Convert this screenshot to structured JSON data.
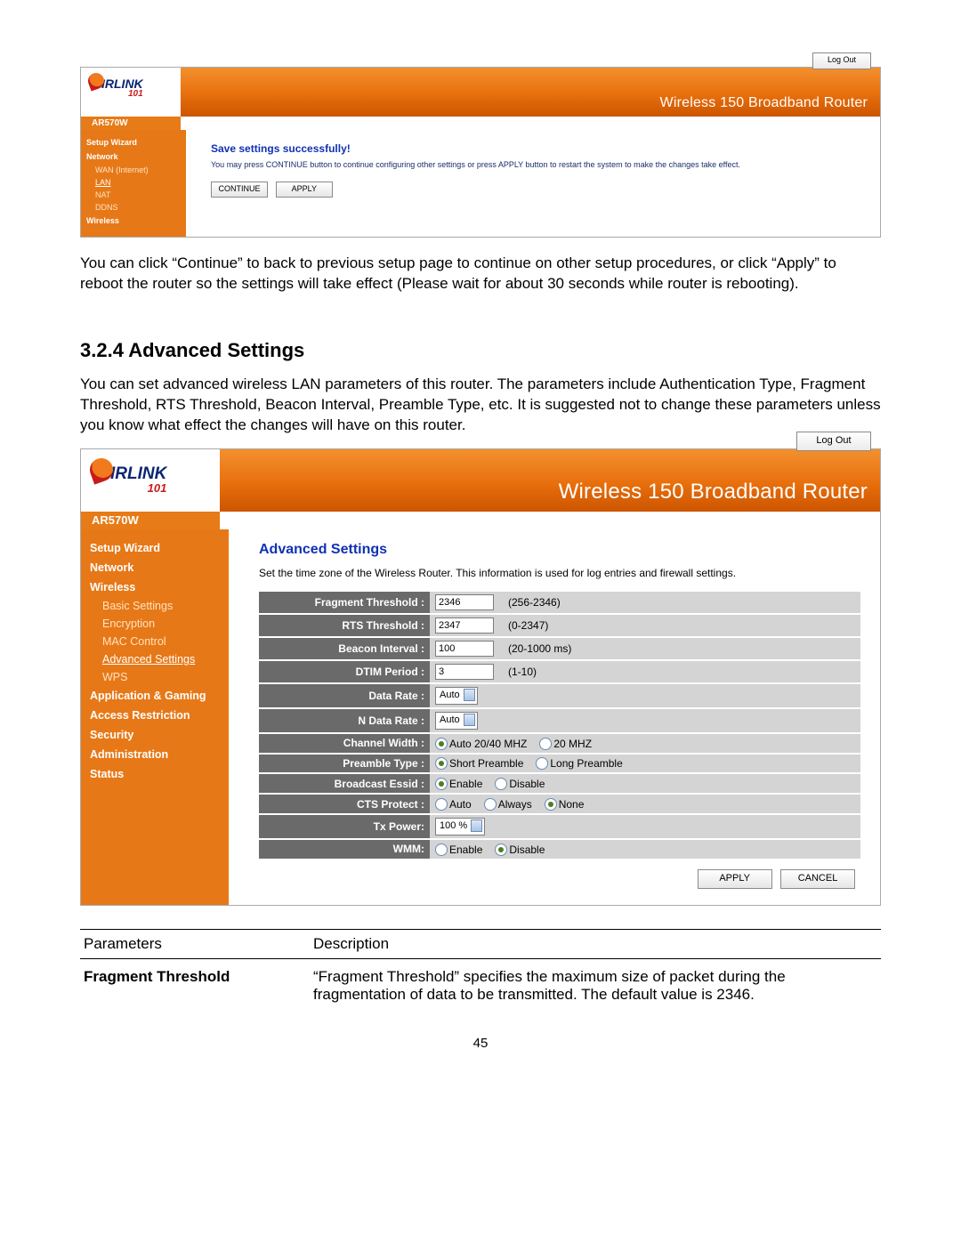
{
  "panel1": {
    "logout": "Log Out",
    "heading": "Wireless 150 Broadband Router",
    "model": "AR570W",
    "sidebar": {
      "items": [
        {
          "label": "Setup Wizard",
          "type": "sec"
        },
        {
          "label": "Network",
          "type": "sec"
        },
        {
          "label": "WAN (Internet)",
          "type": "sub"
        },
        {
          "label": "LAN",
          "type": "sub",
          "sel": true
        },
        {
          "label": "NAT",
          "type": "sub"
        },
        {
          "label": "DDNS",
          "type": "sub"
        },
        {
          "label": "Wireless",
          "type": "sec"
        }
      ]
    },
    "content": {
      "title": "Save settings successfully!",
      "hint": "You may press CONTINUE button to continue configuring other settings or press APPLY button to restart the system to make the changes take effect.",
      "btn_continue": "CONTINUE",
      "btn_apply": "APPLY"
    }
  },
  "para1": "You can click “Continue” to back to previous setup page to continue on other setup procedures, or click “Apply” to reboot the router so the settings will take effect (Please wait for about 30 seconds while router is rebooting).",
  "section_title": "3.2.4 Advanced Settings",
  "para2": "You can set advanced wireless LAN parameters of this router. The parameters include Authentication Type, Fragment Threshold, RTS Threshold, Beacon Interval, Preamble Type, etc. It is suggested not to change these parameters unless you know what effect the changes will have on this router.",
  "panel2": {
    "logout": "Log Out",
    "heading": "Wireless 150 Broadband Router",
    "model": "AR570W",
    "sidebar": {
      "items": [
        {
          "label": "Setup Wizard",
          "type": "sec"
        },
        {
          "label": "Network",
          "type": "sec"
        },
        {
          "label": "Wireless",
          "type": "sec"
        },
        {
          "label": "Basic Settings",
          "type": "sub"
        },
        {
          "label": "Encryption",
          "type": "sub"
        },
        {
          "label": "MAC Control",
          "type": "sub"
        },
        {
          "label": "Advanced Settings",
          "type": "sub",
          "sel": true
        },
        {
          "label": "WPS",
          "type": "sub"
        },
        {
          "label": "Application & Gaming",
          "type": "sec"
        },
        {
          "label": "Access Restriction",
          "type": "sec"
        },
        {
          "label": "Security",
          "type": "sec"
        },
        {
          "label": "Administration",
          "type": "sec"
        },
        {
          "label": "Status",
          "type": "sec"
        }
      ]
    },
    "content": {
      "title": "Advanced Settings",
      "hint": "Set the time zone of the Wireless Router. This information is used for log entries and firewall settings.",
      "rows": [
        {
          "label": "Fragment Threshold :",
          "kind": "input",
          "value": "2346",
          "note": "(256-2346)"
        },
        {
          "label": "RTS Threshold :",
          "kind": "input",
          "value": "2347",
          "note": "(0-2347)"
        },
        {
          "label": "Beacon Interval :",
          "kind": "input",
          "value": "100",
          "note": "(20-1000 ms)"
        },
        {
          "label": "DTIM Period :",
          "kind": "input",
          "value": "3",
          "note": "(1-10)"
        },
        {
          "label": "Data Rate :",
          "kind": "select",
          "value": "Auto"
        },
        {
          "label": "N Data Rate :",
          "kind": "select",
          "value": "Auto"
        },
        {
          "label": "Channel Width :",
          "kind": "radio",
          "options": [
            {
              "text": "Auto 20/40 MHZ",
              "on": true
            },
            {
              "text": "20 MHZ",
              "on": false
            }
          ]
        },
        {
          "label": "Preamble Type :",
          "kind": "radio",
          "options": [
            {
              "text": "Short Preamble",
              "on": true
            },
            {
              "text": "Long Preamble",
              "on": false
            }
          ]
        },
        {
          "label": "Broadcast Essid :",
          "kind": "radio",
          "options": [
            {
              "text": "Enable",
              "on": true
            },
            {
              "text": "Disable",
              "on": false
            }
          ]
        },
        {
          "label": "CTS Protect :",
          "kind": "radio",
          "options": [
            {
              "text": "Auto",
              "on": false
            },
            {
              "text": "Always",
              "on": false
            },
            {
              "text": "None",
              "on": true
            }
          ]
        },
        {
          "label": "Tx Power:",
          "kind": "select",
          "value": "100 %"
        },
        {
          "label": "WMM:",
          "kind": "radio",
          "options": [
            {
              "text": "Enable",
              "on": false
            },
            {
              "text": "Disable",
              "on": true
            }
          ]
        }
      ],
      "btn_apply": "APPLY",
      "btn_cancel": "CANCEL"
    }
  },
  "doc_table": {
    "hdr_param": "Parameters",
    "hdr_desc": "Description",
    "row1_param": "Fragment Threshold",
    "row1_desc": "“Fragment Threshold” specifies the maximum size of packet during the fragmentation of data to be transmitted. The default value is 2346."
  },
  "page_number": "45"
}
